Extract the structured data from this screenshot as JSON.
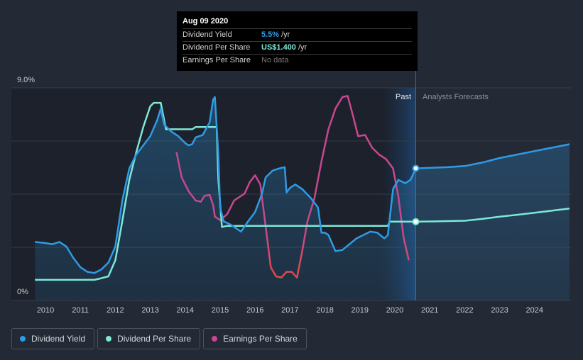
{
  "tooltip": {
    "date": "Aug 09 2020",
    "rows": {
      "yield_label": "Dividend Yield",
      "yield_value": "5.5%",
      "yield_unit": "/yr",
      "dps_label": "Dividend Per Share",
      "dps_value": "US$1.400",
      "dps_unit": "/yr",
      "eps_label": "Earnings Per Share",
      "eps_value": "No data"
    }
  },
  "legend": [
    {
      "label": "Dividend Yield",
      "color": "#2f9be4"
    },
    {
      "label": "Dividend Per Share",
      "color": "#7ce8d8"
    },
    {
      "label": "Earnings Per Share",
      "color": "#c8478f"
    }
  ],
  "chart_data": {
    "type": "line",
    "y_top_label": "9.0%",
    "y_bottom_label": "0%",
    "ylim": [
      0,
      9.0
    ],
    "xlim": [
      2009.5,
      2025.0
    ],
    "x_ticks": [
      "2010",
      "2011",
      "2012",
      "2013",
      "2014",
      "2015",
      "2016",
      "2017",
      "2018",
      "2019",
      "2020",
      "2021",
      "2022",
      "2023",
      "2024"
    ],
    "past_label": "Past",
    "forecast_label": "Analysts Forecasts",
    "divider_x": 2020.6,
    "shade_start_x": 2019.6,
    "colors": {
      "yield": "#2f9be4",
      "dps": "#7ce8d8",
      "eps": "#c8478f",
      "eps_low": "#e0484c"
    },
    "series": [
      {
        "name": "Dividend Yield",
        "key": "yield",
        "past": [
          [
            2009.7,
            2.3
          ],
          [
            2010.0,
            2.25
          ],
          [
            2010.2,
            2.2
          ],
          [
            2010.4,
            2.3
          ],
          [
            2010.6,
            2.1
          ],
          [
            2010.8,
            1.6
          ],
          [
            2011.0,
            1.2
          ],
          [
            2011.2,
            1.0
          ],
          [
            2011.4,
            0.95
          ],
          [
            2011.6,
            1.1
          ],
          [
            2011.8,
            1.4
          ],
          [
            2012.0,
            2.1
          ],
          [
            2012.2,
            4.1
          ],
          [
            2012.4,
            5.5
          ],
          [
            2012.6,
            6.1
          ],
          [
            2012.8,
            6.5
          ],
          [
            2013.0,
            6.9
          ],
          [
            2013.2,
            7.6
          ],
          [
            2013.3,
            8.1
          ],
          [
            2013.4,
            7.4
          ],
          [
            2013.6,
            7.1
          ],
          [
            2013.8,
            6.9
          ],
          [
            2014.0,
            6.6
          ],
          [
            2014.1,
            6.5
          ],
          [
            2014.2,
            6.55
          ],
          [
            2014.3,
            6.85
          ],
          [
            2014.5,
            6.95
          ],
          [
            2014.7,
            7.5
          ],
          [
            2014.8,
            8.5
          ],
          [
            2014.85,
            8.6
          ],
          [
            2014.95,
            6.1
          ],
          [
            2015.0,
            3.8
          ],
          [
            2015.1,
            3.2
          ],
          [
            2015.3,
            3.05
          ],
          [
            2015.6,
            2.75
          ],
          [
            2015.8,
            3.2
          ],
          [
            2016.0,
            3.6
          ],
          [
            2016.2,
            4.4
          ],
          [
            2016.3,
            5.1
          ],
          [
            2016.5,
            5.4
          ],
          [
            2016.7,
            5.5
          ],
          [
            2016.85,
            5.55
          ],
          [
            2016.9,
            4.45
          ],
          [
            2017.0,
            4.65
          ],
          [
            2017.15,
            4.8
          ],
          [
            2017.35,
            4.6
          ],
          [
            2017.6,
            4.2
          ],
          [
            2017.8,
            3.8
          ],
          [
            2017.9,
            2.7
          ],
          [
            2018.0,
            2.7
          ],
          [
            2018.1,
            2.6
          ],
          [
            2018.3,
            1.9
          ],
          [
            2018.5,
            1.95
          ],
          [
            2018.7,
            2.2
          ],
          [
            2018.9,
            2.45
          ],
          [
            2019.1,
            2.6
          ],
          [
            2019.3,
            2.75
          ],
          [
            2019.5,
            2.7
          ],
          [
            2019.7,
            2.45
          ],
          [
            2019.8,
            2.6
          ],
          [
            2019.95,
            4.6
          ],
          [
            2020.1,
            5.0
          ],
          [
            2020.3,
            4.85
          ],
          [
            2020.45,
            5.0
          ],
          [
            2020.6,
            5.5
          ]
        ],
        "forecast": [
          [
            2020.6,
            5.5
          ],
          [
            2021.0,
            5.52
          ],
          [
            2021.5,
            5.55
          ],
          [
            2022.0,
            5.6
          ],
          [
            2022.5,
            5.75
          ],
          [
            2023.0,
            5.95
          ],
          [
            2023.5,
            6.1
          ],
          [
            2024.0,
            6.25
          ],
          [
            2024.5,
            6.4
          ],
          [
            2025.0,
            6.55
          ]
        ]
      },
      {
        "name": "Dividend Per Share",
        "key": "dps",
        "past": [
          [
            2009.7,
            0.65
          ],
          [
            2010.0,
            0.65
          ],
          [
            2010.5,
            0.65
          ],
          [
            2011.0,
            0.65
          ],
          [
            2011.4,
            0.65
          ],
          [
            2011.6,
            0.72
          ],
          [
            2011.8,
            0.8
          ],
          [
            2012.0,
            1.5
          ],
          [
            2012.2,
            3.2
          ],
          [
            2012.4,
            5.0
          ],
          [
            2012.6,
            6.2
          ],
          [
            2012.8,
            7.3
          ],
          [
            2013.0,
            8.2
          ],
          [
            2013.1,
            8.35
          ],
          [
            2013.3,
            8.35
          ],
          [
            2013.45,
            7.2
          ],
          [
            2013.6,
            7.2
          ],
          [
            2014.0,
            7.2
          ],
          [
            2014.2,
            7.2
          ],
          [
            2014.3,
            7.3
          ],
          [
            2014.5,
            7.3
          ],
          [
            2014.9,
            7.3
          ],
          [
            2014.95,
            5.0
          ],
          [
            2015.05,
            2.95
          ],
          [
            2015.2,
            3.0
          ],
          [
            2015.5,
            3.0
          ],
          [
            2016.0,
            3.0
          ],
          [
            2017.0,
            3.0
          ],
          [
            2018.0,
            3.0
          ],
          [
            2019.0,
            3.0
          ],
          [
            2019.8,
            3.0
          ],
          [
            2019.85,
            3.18
          ],
          [
            2020.6,
            3.18
          ]
        ],
        "forecast": [
          [
            2020.6,
            3.18
          ],
          [
            2021.0,
            3.19
          ],
          [
            2022.0,
            3.22
          ],
          [
            2022.5,
            3.3
          ],
          [
            2023.0,
            3.4
          ],
          [
            2023.5,
            3.48
          ],
          [
            2024.0,
            3.57
          ],
          [
            2024.5,
            3.66
          ],
          [
            2025.0,
            3.75
          ]
        ]
      },
      {
        "name": "Earnings Per Share",
        "key": "eps",
        "past": [
          [
            2013.75,
            6.2
          ],
          [
            2013.9,
            5.1
          ],
          [
            2014.1,
            4.5
          ],
          [
            2014.3,
            4.1
          ],
          [
            2014.45,
            4.05
          ],
          [
            2014.55,
            4.3
          ],
          [
            2014.7,
            4.35
          ],
          [
            2014.8,
            3.9
          ],
          [
            2014.85,
            3.4
          ],
          [
            2015.0,
            3.25
          ],
          [
            2015.2,
            3.5
          ],
          [
            2015.4,
            4.1
          ],
          [
            2015.7,
            4.4
          ],
          [
            2015.85,
            4.9
          ],
          [
            2016.0,
            5.2
          ],
          [
            2016.15,
            4.8
          ],
          [
            2016.3,
            3.0
          ],
          [
            2016.45,
            1.2
          ],
          [
            2016.6,
            0.8
          ],
          [
            2016.75,
            0.75
          ],
          [
            2016.9,
            1.0
          ],
          [
            2017.05,
            1.0
          ],
          [
            2017.2,
            0.75
          ],
          [
            2017.35,
            1.9
          ],
          [
            2017.5,
            3.2
          ],
          [
            2017.7,
            4.2
          ],
          [
            2017.9,
            5.8
          ],
          [
            2018.1,
            7.2
          ],
          [
            2018.3,
            8.1
          ],
          [
            2018.5,
            8.6
          ],
          [
            2018.65,
            8.65
          ],
          [
            2018.8,
            7.8
          ],
          [
            2018.95,
            6.9
          ],
          [
            2019.15,
            6.95
          ],
          [
            2019.35,
            6.4
          ],
          [
            2019.55,
            6.1
          ],
          [
            2019.75,
            5.9
          ],
          [
            2019.95,
            5.5
          ],
          [
            2020.1,
            4.3
          ],
          [
            2020.25,
            2.5
          ],
          [
            2020.4,
            1.5
          ]
        ]
      }
    ]
  }
}
